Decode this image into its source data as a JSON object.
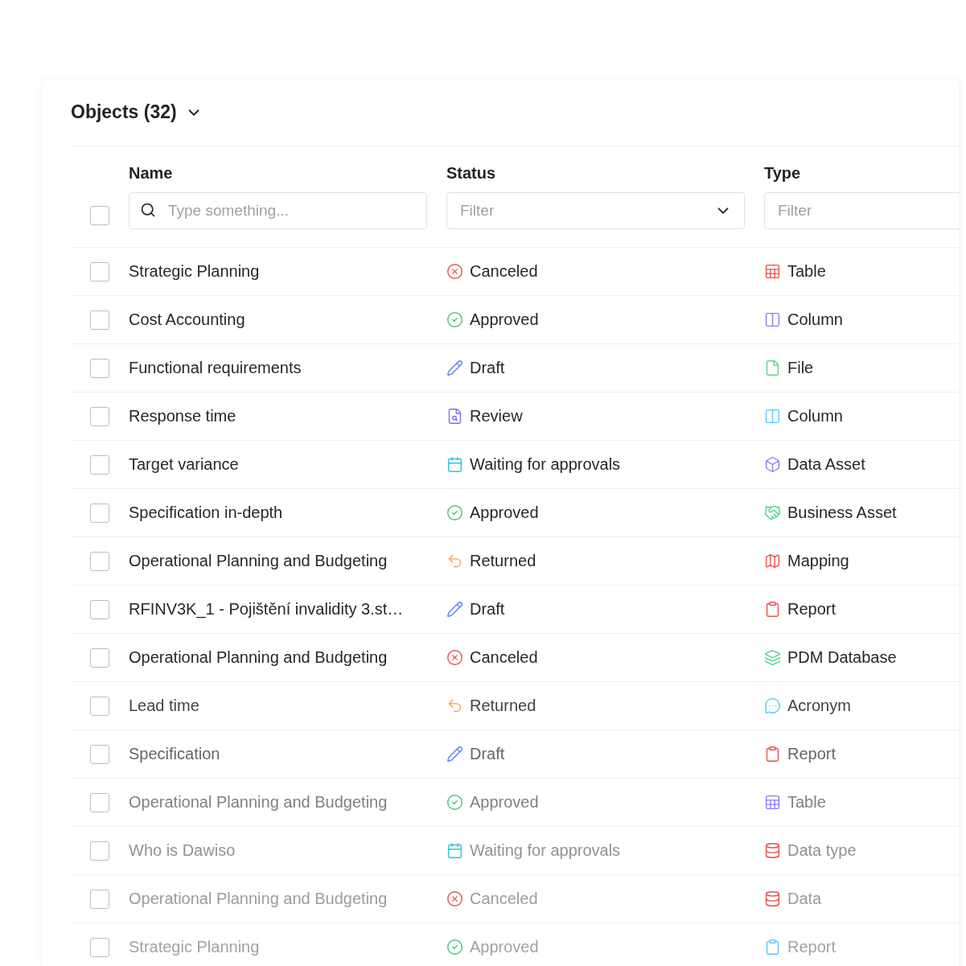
{
  "header": {
    "title": "Objects (32)"
  },
  "columns": [
    {
      "label": "Name",
      "filter": {
        "kind": "search",
        "placeholder": "Type something..."
      }
    },
    {
      "label": "Status",
      "filter": {
        "kind": "select",
        "placeholder": "Filter"
      }
    },
    {
      "label": "Type",
      "filter": {
        "kind": "text",
        "placeholder": "Filter"
      }
    }
  ],
  "select_all": {
    "checked": false
  },
  "rows": [
    {
      "checked": false,
      "name": "Strategic Planning",
      "status": {
        "kind": "canceled",
        "label": "Canceled"
      },
      "type": {
        "kind": "table",
        "label": "Table",
        "color": "#e5534b"
      }
    },
    {
      "checked": false,
      "name": "Cost Accounting",
      "status": {
        "kind": "approved",
        "label": "Approved"
      },
      "type": {
        "kind": "column",
        "label": "Column",
        "color": "#8b7cf6"
      }
    },
    {
      "checked": false,
      "name": "Functional requirements",
      "status": {
        "kind": "draft",
        "label": "Draft"
      },
      "type": {
        "kind": "file",
        "label": "File",
        "color": "#5fd38d"
      }
    },
    {
      "checked": false,
      "name": "Response time",
      "status": {
        "kind": "review",
        "label": "Review"
      },
      "type": {
        "kind": "column",
        "label": "Column",
        "color": "#5ac8fa"
      }
    },
    {
      "checked": false,
      "name": "Target variance",
      "status": {
        "kind": "waiting",
        "label": "Waiting for approvals"
      },
      "type": {
        "kind": "data-asset",
        "label": "Data Asset",
        "color": "#8b7cf6"
      }
    },
    {
      "checked": false,
      "name": "Specification in-depth",
      "status": {
        "kind": "approved",
        "label": "Approved"
      },
      "type": {
        "kind": "business-asset",
        "label": "Business Asset",
        "color": "#4fd18b"
      }
    },
    {
      "checked": false,
      "name": "Operational Planning and Budgeting",
      "status": {
        "kind": "returned",
        "label": "Returned"
      },
      "type": {
        "kind": "mapping",
        "label": "Mapping",
        "color": "#e5534b"
      }
    },
    {
      "checked": false,
      "name": "RFINV3K_1 - Pojištění invalidity 3.st…",
      "status": {
        "kind": "draft",
        "label": "Draft"
      },
      "type": {
        "kind": "report",
        "label": "Report",
        "color": "#e5534b"
      }
    },
    {
      "checked": false,
      "name": "Operational Planning and Budgeting",
      "status": {
        "kind": "canceled",
        "label": "Canceled"
      },
      "type": {
        "kind": "database",
        "label": "PDM Database",
        "color": "#4fd18b"
      }
    },
    {
      "checked": false,
      "name": "Lead time",
      "status": {
        "kind": "returned",
        "label": "Returned"
      },
      "type": {
        "kind": "acronym",
        "label": "Acronym",
        "color": "#5ac8fa"
      }
    },
    {
      "checked": false,
      "name": "Specification",
      "status": {
        "kind": "draft",
        "label": "Draft"
      },
      "type": {
        "kind": "report",
        "label": "Report",
        "color": "#e5534b"
      }
    },
    {
      "checked": false,
      "name": "Operational Planning and Budgeting",
      "status": {
        "kind": "approved",
        "label": "Approved"
      },
      "type": {
        "kind": "table",
        "label": "Table",
        "color": "#8b7cf6"
      }
    },
    {
      "checked": false,
      "name": "Who is Dawiso",
      "status": {
        "kind": "waiting",
        "label": "Waiting for approvals"
      },
      "type": {
        "kind": "data",
        "label": "Data type",
        "color": "#e5534b"
      }
    },
    {
      "checked": false,
      "name": "Operational Planning and Budgeting",
      "status": {
        "kind": "canceled",
        "label": "Canceled"
      },
      "type": {
        "kind": "data",
        "label": "Data",
        "color": "#e5534b"
      }
    },
    {
      "checked": false,
      "name": "Strategic Planning",
      "status": {
        "kind": "approved",
        "label": "Approved"
      },
      "type": {
        "kind": "report",
        "label": "Report",
        "color": "#5ac8fa"
      }
    }
  ]
}
